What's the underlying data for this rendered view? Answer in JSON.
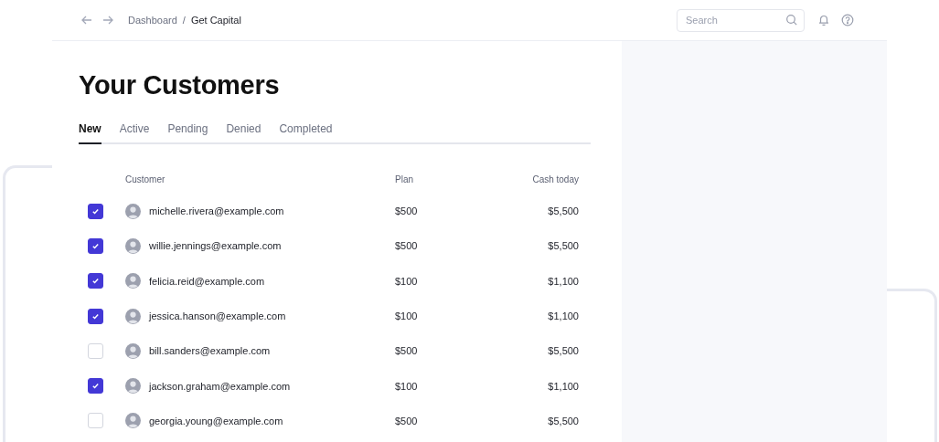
{
  "breadcrumb": {
    "separator": "/",
    "items": [
      {
        "label": "Dashboard",
        "selected": false
      },
      {
        "label": "Get Capital",
        "selected": true
      }
    ]
  },
  "search": {
    "placeholder": "Search"
  },
  "title": "Your Customers",
  "tabs": [
    {
      "label": "New",
      "selected": true
    },
    {
      "label": "Active",
      "selected": false
    },
    {
      "label": "Pending",
      "selected": false
    },
    {
      "label": "Denied",
      "selected": false
    },
    {
      "label": "Completed",
      "selected": false
    }
  ],
  "table": {
    "columns": [
      "Customer",
      "Plan",
      "Cash today"
    ],
    "rows": [
      {
        "checked": true,
        "customer": "michelle.rivera@example.com",
        "plan": "$500",
        "cash_today": "$5,500"
      },
      {
        "checked": true,
        "customer": "willie.jennings@example.com",
        "plan": "$500",
        "cash_today": "$5,500"
      },
      {
        "checked": true,
        "customer": "felicia.reid@example.com",
        "plan": "$100",
        "cash_today": "$1,100"
      },
      {
        "checked": true,
        "customer": "jessica.hanson@example.com",
        "plan": "$100",
        "cash_today": "$1,100"
      },
      {
        "checked": false,
        "customer": "bill.sanders@example.com",
        "plan": "$500",
        "cash_today": "$5,500"
      },
      {
        "checked": true,
        "customer": "jackson.graham@example.com",
        "plan": "$100",
        "cash_today": "$1,100"
      },
      {
        "checked": false,
        "customer": "georgia.young@example.com",
        "plan": "$500",
        "cash_today": "$5,500"
      }
    ]
  }
}
